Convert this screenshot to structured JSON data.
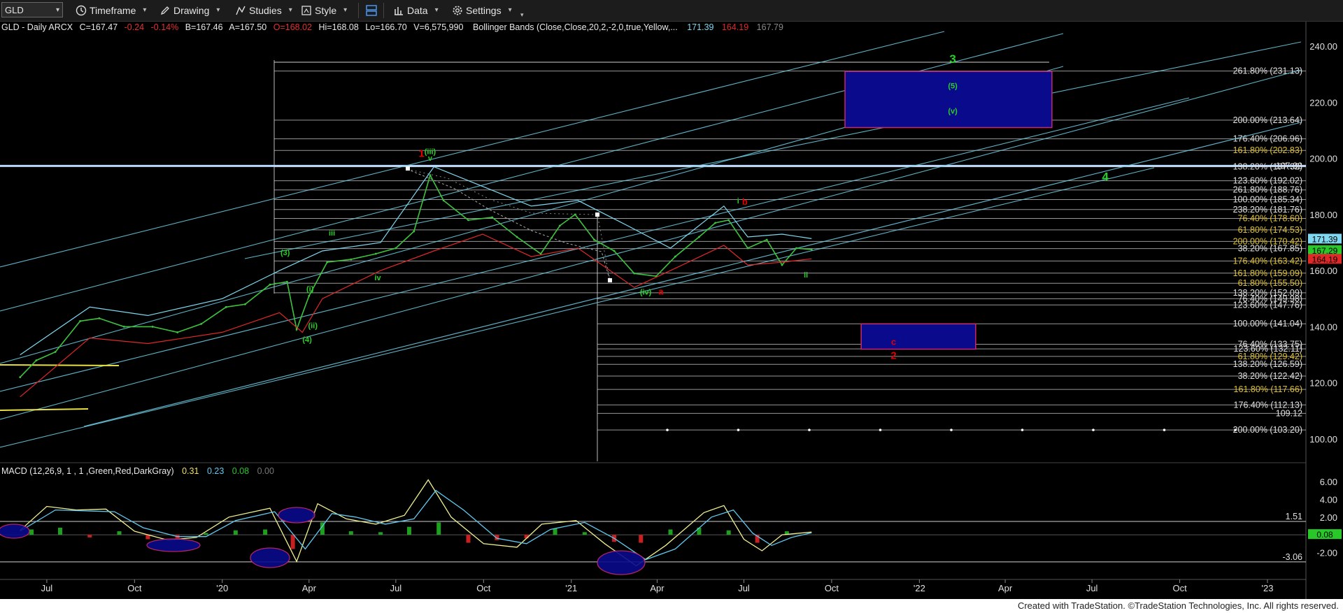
{
  "toolbar": {
    "symbol": "GLD",
    "buttons": [
      {
        "label": "Timeframe",
        "icon": "clock-icon"
      },
      {
        "label": "Drawing",
        "icon": "pencil-icon"
      },
      {
        "label": "Studies",
        "icon": "studies-icon"
      },
      {
        "label": "Style",
        "icon": "style-icon"
      },
      {
        "label": "Data",
        "icon": "data-icon"
      },
      {
        "label": "Settings",
        "icon": "gear-icon"
      }
    ]
  },
  "legend": {
    "symbol_line": "GLD - Daily  ARCX",
    "last": "C=167.47",
    "change": "-0.24",
    "change_pct": "-0.14%",
    "bid": "B=167.46",
    "ask": "A=167.50",
    "open": "O=168.02",
    "high": "Hi=168.08",
    "low": "Lo=166.70",
    "volume": "V=6,575,990",
    "bb_label": "Bollinger Bands (Close,Close,20,2,-2,0,true,Yellow,...",
    "bb_upper": "171.39",
    "bb_lower": "164.19",
    "bb_mid": "167.79"
  },
  "macd_legend": {
    "label": "MACD (12,26,9, 1 , 1 ,Green,Red,DarkGray)",
    "v1": "0.31",
    "v2": "0.23",
    "v3": "0.08",
    "v4": "0.00"
  },
  "colors": {
    "price": "#3ec33e",
    "bb_upper": "#7fd8f0",
    "bb_lower": "#e02828",
    "channel": "#6fd0e8",
    "fib": "#d8d8d8",
    "wave_red": "#e00000",
    "wave_green": "#28d028",
    "box_blue": "#0a0a8c",
    "box_border": "#c8286e",
    "macd_pos": "#1ea01e",
    "macd_neg": "#c82020",
    "macd_line": "#f0f090",
    "signal_line": "#60c8f0"
  },
  "chart_data": [
    {
      "type": "line",
      "title": "GLD - Daily",
      "xlabel": "",
      "ylabel": "",
      "x_ticks": [
        "Jul",
        "Oct",
        "'20",
        "Apr",
        "Jul",
        "Oct",
        "'21",
        "Apr",
        "Jul",
        "Oct",
        "'22",
        "Apr",
        "Jul",
        "Oct",
        "'23"
      ],
      "y_ticks": [
        100,
        120,
        140,
        160,
        180,
        200,
        220,
        240
      ],
      "ylim": [
        97,
        244
      ],
      "series": [
        {
          "name": "Close",
          "x": [
            "2019-06-03",
            "2019-06-20",
            "2019-07-10",
            "2019-08-05",
            "2019-08-25",
            "2019-09-20",
            "2019-10-20",
            "2019-11-15",
            "2019-12-10",
            "2020-01-05",
            "2020-01-25",
            "2020-02-20",
            "2020-03-09",
            "2020-03-19",
            "2020-04-01",
            "2020-04-20",
            "2020-05-15",
            "2020-06-10",
            "2020-07-01",
            "2020-07-20",
            "2020-08-06",
            "2020-08-20",
            "2020-09-15",
            "2020-10-10",
            "2020-11-05",
            "2020-11-30",
            "2020-12-20",
            "2021-01-05",
            "2021-01-25",
            "2021-02-15",
            "2021-03-08",
            "2021-03-31",
            "2021-04-20",
            "2021-05-15",
            "2021-06-01",
            "2021-06-15",
            "2021-07-05",
            "2021-07-25",
            "2021-08-10",
            "2021-08-25",
            "2021-09-10"
          ],
          "values": [
            122,
            128,
            131,
            142,
            143,
            140,
            140,
            138,
            141,
            147,
            148,
            155,
            156,
            139,
            151,
            163,
            164,
            166,
            168,
            174,
            194,
            185,
            178,
            179,
            172,
            166,
            176,
            180,
            171,
            167,
            159,
            158,
            165,
            172,
            177,
            178,
            168,
            171,
            162,
            168,
            167.5
          ]
        },
        {
          "name": "Bollinger Upper",
          "x": [
            "2019-06-03",
            "2019-08-15",
            "2019-10-15",
            "2020-01-01",
            "2020-03-01",
            "2020-04-15",
            "2020-06-15",
            "2020-08-10",
            "2020-09-30",
            "2020-11-20",
            "2021-01-08",
            "2021-03-01",
            "2021-04-15",
            "2021-06-10",
            "2021-07-05",
            "2021-08-10",
            "2021-09-10"
          ],
          "values": [
            130,
            147,
            144,
            150,
            160,
            167,
            170,
            197,
            190,
            183,
            185,
            176,
            168,
            183,
            172,
            173,
            171.4
          ]
        },
        {
          "name": "Bollinger Lower",
          "x": [
            "2019-06-03",
            "2019-08-15",
            "2019-10-15",
            "2020-01-01",
            "2020-03-01",
            "2020-03-25",
            "2020-04-15",
            "2020-06-15",
            "2020-08-10",
            "2020-09-30",
            "2020-11-20",
            "2021-01-08",
            "2021-03-08",
            "2021-04-15",
            "2021-06-10",
            "2021-07-05",
            "2021-08-10",
            "2021-09-10"
          ],
          "values": [
            115,
            136,
            134,
            138,
            145,
            138,
            150,
            160,
            167,
            173,
            165,
            168,
            154,
            160,
            169,
            162,
            163,
            164.2
          ]
        }
      ],
      "fib_levels": [
        {
          "label": "261.80% (231.13)",
          "value": 231.13
        },
        {
          "label": "200.00% (213.64)",
          "value": 213.64
        },
        {
          "label": "176.40% (206.96)",
          "value": 206.96
        },
        {
          "label": "161.80% (202.83)",
          "value": 202.83
        },
        {
          "label": "197.32",
          "value": 197.32
        },
        {
          "label": "138.20% (197.32)",
          "value": 197.0
        },
        {
          "label": "123.60% (192.02)",
          "value": 192.02
        },
        {
          "label": "261.80% (188.76)",
          "value": 188.76
        },
        {
          "label": "100.00% (185.34)",
          "value": 185.34
        },
        {
          "label": "238.20% (181.76)",
          "value": 181.76
        },
        {
          "label": "76.40% (178.60)",
          "value": 178.6
        },
        {
          "label": "61.80% (174.53)",
          "value": 174.53
        },
        {
          "label": "200.00% (170.42)",
          "value": 170.42
        },
        {
          "label": "38.20% (167.85)",
          "value": 167.85
        },
        {
          "label": "176.40% (163.42)",
          "value": 163.42
        },
        {
          "label": "161.80% (159.09)",
          "value": 159.09
        },
        {
          "label": "61.80% (155.50)",
          "value": 155.5
        },
        {
          "label": "138.20% (152.09)",
          "value": 152.09
        },
        {
          "label": "76.40% (149.98)",
          "value": 149.98
        },
        {
          "label": "123.60% (147.76)",
          "value": 147.76
        },
        {
          "label": "100.00% (141.04)",
          "value": 141.04
        },
        {
          "label": "76.40% (133.75)",
          "value": 133.75
        },
        {
          "label": "123.60% (132.11)",
          "value": 132.11
        },
        {
          "label": "61.80% (129.42)",
          "value": 129.42
        },
        {
          "label": "138.20% (126.59)",
          "value": 126.59
        },
        {
          "label": "38.20% (122.42)",
          "value": 122.42
        },
        {
          "label": "161.80% (117.66)",
          "value": 117.66
        },
        {
          "label": "176.40% (112.13)",
          "value": 112.13
        },
        {
          "label": "109.12",
          "value": 109.12
        },
        {
          "label": "200.00% (103.20)",
          "value": 103.2
        }
      ],
      "price_badges": [
        {
          "value": 171.39,
          "label": "171.39",
          "bg": "#7fd8f0"
        },
        {
          "value": 167.29,
          "label": "167.29",
          "bg": "#28c828"
        },
        {
          "value": 164.19,
          "label": "164.19",
          "bg": "#e02828"
        }
      ],
      "boxes": [
        {
          "x0": "2021-10-15",
          "x1": "2022-05-20",
          "y0": 211,
          "y1": 231
        },
        {
          "x0": "2021-11-01",
          "x1": "2022-03-01",
          "y0": 132,
          "y1": 141
        }
      ],
      "wave_labels": [
        {
          "text": "1",
          "x": "2020-07-28",
          "y": 200.5,
          "color": "red",
          "size": 15
        },
        {
          "text": "(iii)",
          "x": "2020-08-06",
          "y": 201.5,
          "color": "green",
          "size": 11
        },
        {
          "text": "v",
          "x": "2020-08-06",
          "y": 199.2,
          "color": "green",
          "size": 11
        },
        {
          "text": "iii",
          "x": "2020-04-25",
          "y": 172.5,
          "color": "green",
          "size": 11
        },
        {
          "text": "(3)",
          "x": "2020-03-07",
          "y": 165.5,
          "color": "green",
          "size": 11
        },
        {
          "text": "(i)",
          "x": "2020-04-02",
          "y": 152.5,
          "color": "green",
          "size": 11
        },
        {
          "text": "(ii)",
          "x": "2020-04-05",
          "y": 139.5,
          "color": "green",
          "size": 11
        },
        {
          "text": "(4)",
          "x": "2020-03-30",
          "y": 134.5,
          "color": "green",
          "size": 11
        },
        {
          "text": "iv",
          "x": "2020-06-12",
          "y": 156.5,
          "color": "green",
          "size": 11
        },
        {
          "text": "(iv)",
          "x": "2021-03-20",
          "y": 151.5,
          "color": "green",
          "size": 11
        },
        {
          "text": "a",
          "x": "2021-04-05",
          "y": 151.5,
          "color": "red",
          "size": 13
        },
        {
          "text": "i",
          "x": "2021-06-25",
          "y": 184,
          "color": "green",
          "size": 11
        },
        {
          "text": "b",
          "x": "2021-07-02",
          "y": 183.5,
          "color": "red",
          "size": 13
        },
        {
          "text": "ii",
          "x": "2021-09-04",
          "y": 157.5,
          "color": "green",
          "size": 11
        },
        {
          "text": "3",
          "x": "2022-02-05",
          "y": 234,
          "color": "green",
          "size": 17
        },
        {
          "text": "(5)",
          "x": "2022-02-05",
          "y": 225,
          "color": "green",
          "size": 11
        },
        {
          "text": "(v)",
          "x": "2022-02-05",
          "y": 216,
          "color": "green",
          "size": 11
        },
        {
          "text": "4",
          "x": "2022-07-15",
          "y": 192,
          "color": "green",
          "size": 17
        },
        {
          "text": "c",
          "x": "2021-12-05",
          "y": 133.5,
          "color": "red",
          "size": 13
        },
        {
          "text": "2",
          "x": "2021-12-05",
          "y": 128.5,
          "color": "red",
          "size": 15
        }
      ]
    },
    {
      "type": "bar",
      "title": "MACD (12,26,9, 1 , 1 ,Green,Red,DarkGray)",
      "y_ticks": [
        6.0,
        4.0,
        2.0,
        -2.0
      ],
      "ylim": [
        -4.8,
        7.5
      ],
      "reference_lines": [
        {
          "value": 1.51,
          "label": "1.51"
        },
        {
          "value": -3.06,
          "label": "-3.06"
        }
      ],
      "badge": {
        "value": 0.08,
        "label": "0.08"
      },
      "series": [
        {
          "name": "MACD",
          "x": [
            "2019-06-03",
            "2019-07-01",
            "2019-08-01",
            "2019-09-01",
            "2019-10-01",
            "2019-11-05",
            "2019-12-05",
            "2020-01-08",
            "2020-02-20",
            "2020-03-19",
            "2020-04-10",
            "2020-05-10",
            "2020-06-10",
            "2020-07-10",
            "2020-08-04",
            "2020-08-28",
            "2020-10-01",
            "2020-11-05",
            "2020-12-01",
            "2021-01-06",
            "2021-02-05",
            "2021-03-10",
            "2021-04-10",
            "2021-05-20",
            "2021-06-10",
            "2021-07-01",
            "2021-07-20",
            "2021-08-10",
            "2021-09-10"
          ],
          "values": [
            0.5,
            3.2,
            2.8,
            2.9,
            0.4,
            -0.6,
            -0.3,
            2.0,
            3.0,
            -3.0,
            3.5,
            1.8,
            1.2,
            2.2,
            6.2,
            2.0,
            -1.0,
            -1.4,
            1.2,
            1.6,
            -1.0,
            -3.5,
            -1.2,
            2.5,
            3.3,
            -0.5,
            -1.8,
            0.0,
            0.31
          ]
        },
        {
          "name": "Signal",
          "x": [
            "2019-06-03",
            "2019-07-10",
            "2019-08-10",
            "2019-09-10",
            "2019-10-10",
            "2019-11-15",
            "2019-12-15",
            "2020-01-15",
            "2020-02-25",
            "2020-03-28",
            "2020-04-25",
            "2020-05-20",
            "2020-06-20",
            "2020-07-20",
            "2020-08-12",
            "2020-09-10",
            "2020-10-15",
            "2020-11-15",
            "2020-12-10",
            "2021-01-15",
            "2021-02-15",
            "2021-03-20",
            "2021-04-20",
            "2021-05-28",
            "2021-06-20",
            "2021-07-10",
            "2021-07-30",
            "2021-08-20",
            "2021-09-10"
          ],
          "values": [
            0.4,
            2.8,
            2.7,
            2.6,
            0.8,
            -0.2,
            -0.2,
            1.6,
            2.6,
            -1.6,
            2.4,
            2.0,
            1.2,
            1.8,
            5.0,
            2.8,
            -0.4,
            -1.0,
            0.6,
            1.4,
            -0.4,
            -2.8,
            -1.6,
            2.0,
            2.8,
            0.2,
            -1.2,
            -0.3,
            0.23
          ]
        }
      ],
      "histogram": {
        "x": [
          "2019-06-15",
          "2019-07-15",
          "2019-08-15",
          "2019-09-15",
          "2019-10-15",
          "2019-11-15",
          "2019-12-15",
          "2020-01-15",
          "2020-02-15",
          "2020-03-15",
          "2020-04-15",
          "2020-05-15",
          "2020-06-15",
          "2020-07-15",
          "2020-08-15",
          "2020-09-15",
          "2020-10-15",
          "2020-11-15",
          "2020-12-15",
          "2021-01-15",
          "2021-02-15",
          "2021-03-15",
          "2021-04-15",
          "2021-05-15",
          "2021-06-15",
          "2021-07-15",
          "2021-08-15"
        ],
        "values": [
          0.6,
          0.8,
          -0.3,
          0.4,
          -0.5,
          -0.4,
          0.2,
          0.5,
          0.6,
          -1.6,
          1.4,
          0.4,
          0.3,
          0.9,
          1.4,
          -0.9,
          -0.6,
          -0.4,
          0.7,
          0.3,
          -0.8,
          -0.9,
          0.6,
          0.8,
          0.5,
          -0.9,
          0.4
        ]
      }
    }
  ],
  "footer": {
    "credit": "Created with TradeStation. ©TradeStation Technologies, Inc. All rights reserved."
  }
}
